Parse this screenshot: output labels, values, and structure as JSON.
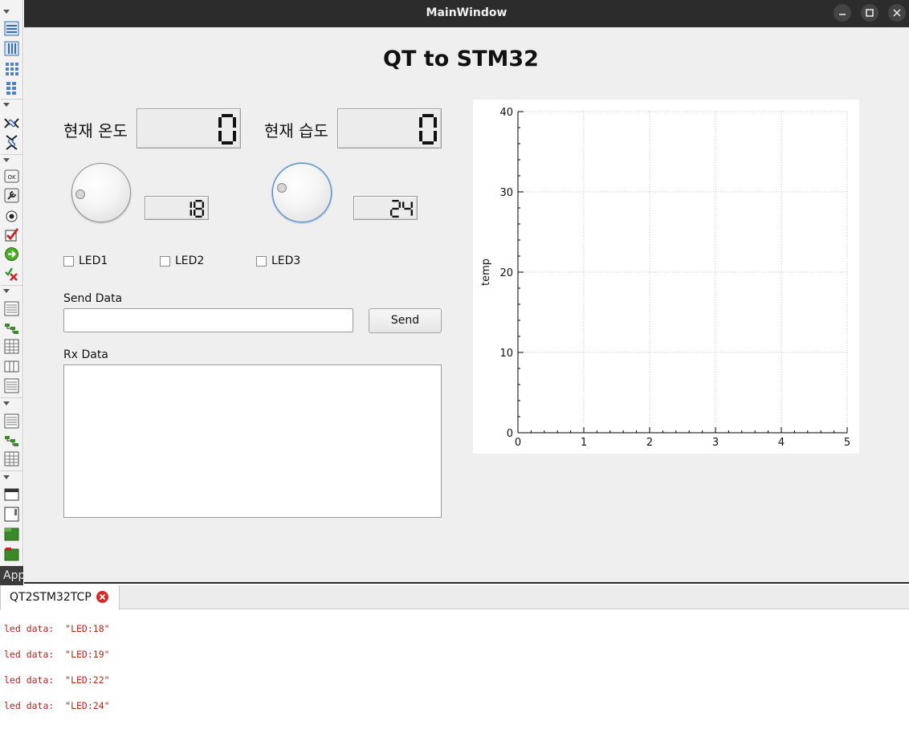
{
  "toolbox": {
    "label": "App",
    "icons": [
      "vertical-layout-icon",
      "horizontal-layout-icon",
      "grid-layout-icon",
      "form-layout-icon",
      "horizontal-spacer-icon",
      "vertical-spacer-icon",
      "push-button-icon",
      "tool-button-icon",
      "radio-button-icon",
      "check-box-icon",
      "command-link-icon",
      "dialog-button-box-icon",
      "list-view-icon",
      "tree-view-icon",
      "table-view-icon",
      "column-view-icon",
      "undo-view-icon",
      "list-widget-icon",
      "tree-widget-icon",
      "table-widget-icon",
      "group-box-icon",
      "scroll-area-icon",
      "tool-box-icon",
      "tab-widget-icon"
    ]
  },
  "window": {
    "title": "MainWindow",
    "controls": [
      "minimize-icon",
      "maximize-icon",
      "close-icon"
    ]
  },
  "app": {
    "title": "QT to STM32",
    "temperature": {
      "label": "현재 온도",
      "lcd_value": "0"
    },
    "humidity": {
      "label": "현재 습도",
      "lcd_value": "0"
    },
    "dial1": {
      "lcd_value": "18"
    },
    "dial2": {
      "lcd_value": "24"
    },
    "leds": [
      {
        "label": "LED1",
        "checked": false
      },
      {
        "label": "LED2",
        "checked": false
      },
      {
        "label": "LED3",
        "checked": false
      }
    ],
    "send": {
      "label": "Send Data",
      "input_value": "",
      "button_label": "Send"
    },
    "rx": {
      "label": "Rx Data",
      "content": ""
    }
  },
  "chart_data": {
    "type": "line",
    "series": [],
    "xlabel": "",
    "ylabel": "temp",
    "xlim": [
      0,
      5
    ],
    "ylim": [
      0,
      40
    ],
    "xticks": [
      0,
      1,
      2,
      3,
      4,
      5
    ],
    "yticks": [
      0,
      10,
      20,
      30,
      40
    ],
    "grid": true
  },
  "output": {
    "tab_label": "QT2STM32TCP",
    "lines": [
      "led data:  \"LED:18\"",
      "led data:  \"LED:19\"",
      "led data:  \"LED:22\"",
      "led data:  \"LED:24\""
    ]
  },
  "colors": {
    "titlebar": "#2c2c2c",
    "window_bg": "#efefef",
    "log_text": "#b3261e",
    "close_badge": "#d52a2a"
  }
}
